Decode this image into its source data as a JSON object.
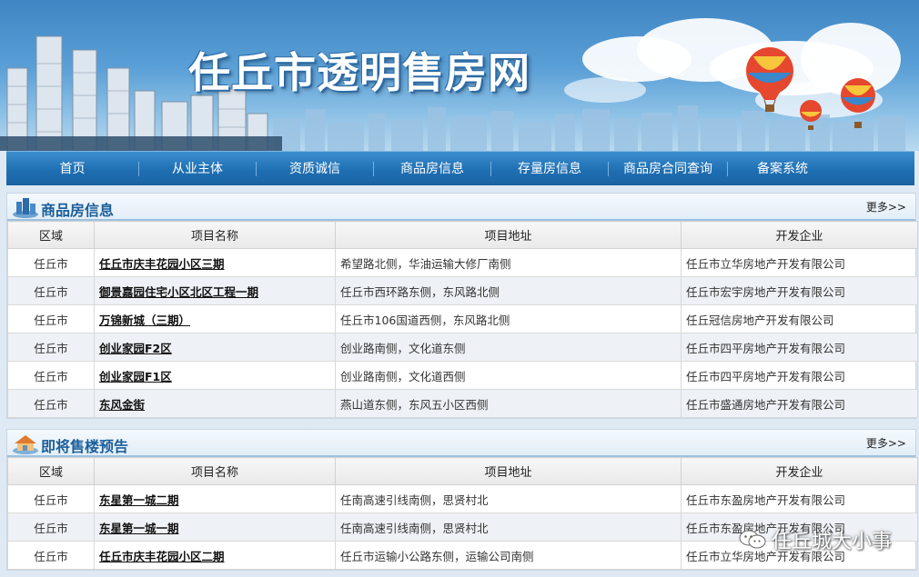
{
  "site": {
    "title": "任丘市透明售房网"
  },
  "nav": {
    "items": [
      {
        "label": "首页"
      },
      {
        "label": "从业主体"
      },
      {
        "label": "资质诚信"
      },
      {
        "label": "商品房信息"
      },
      {
        "label": "存量房信息"
      },
      {
        "label": "商品房合同查询"
      },
      {
        "label": "备案系统"
      }
    ]
  },
  "section1": {
    "title": "商品房信息",
    "more": "更多>>",
    "headers": [
      "区域",
      "项目名称",
      "项目地址",
      "开发企业"
    ],
    "rows": [
      {
        "area": "任丘市",
        "name": "任丘市庆丰花园小区三期",
        "address": "希望路北侧，华油运输大修厂南侧",
        "developer": "任丘市立华房地产开发有限公司"
      },
      {
        "area": "任丘市",
        "name": "御景嘉园住宅小区北区工程一期",
        "address": "任丘市西环路东侧，东风路北侧",
        "developer": "任丘市宏宇房地产开发有限公司"
      },
      {
        "area": "任丘市",
        "name": "万锦新城（三期）",
        "address": "任丘市106国道西侧，东风路北侧",
        "developer": "任丘冠信房地产开发有限公司"
      },
      {
        "area": "任丘市",
        "name": "创业家园F2区",
        "address": "创业路南侧，文化道东侧",
        "developer": "任丘市四平房地产开发有限公司"
      },
      {
        "area": "任丘市",
        "name": "创业家园F1区",
        "address": "创业路南侧，文化道西侧",
        "developer": "任丘市四平房地产开发有限公司"
      },
      {
        "area": "任丘市",
        "name": "东风金街",
        "address": "燕山道东侧，东风五小区西侧",
        "developer": "任丘市盛通房地产开发有限公司"
      }
    ]
  },
  "section2": {
    "title": "即将售楼预告",
    "more": "更多>>",
    "headers": [
      "区域",
      "项目名称",
      "项目地址",
      "开发企业"
    ],
    "rows": [
      {
        "area": "任丘市",
        "name": "东星第一城二期",
        "address": "任南高速引线南侧，思贤村北",
        "developer": "任丘市东盈房地产开发有限公司"
      },
      {
        "area": "任丘市",
        "name": "东星第一城一期",
        "address": "任南高速引线南侧，思贤村北",
        "developer": "任丘市东盈房地产开发有限公司"
      },
      {
        "area": "任丘市",
        "name": "任丘市庆丰花园小区二期",
        "address": "任丘市运输小公路东侧，运输公司南侧",
        "developer": "任丘市立华房地产开发有限公司"
      }
    ]
  },
  "watermark": {
    "text": "任丘城大小事",
    "icon": "wechat-icon"
  }
}
